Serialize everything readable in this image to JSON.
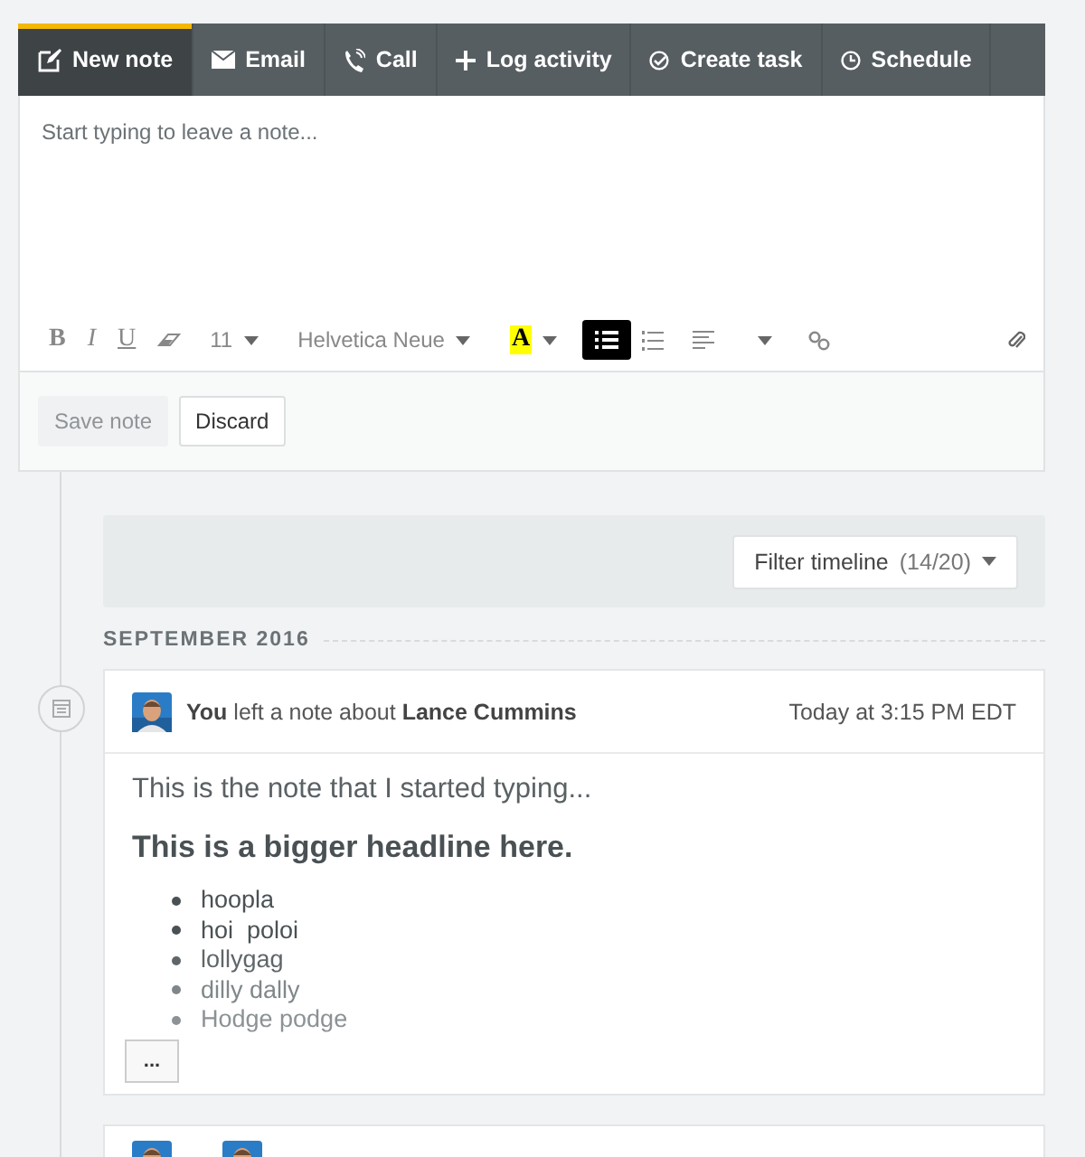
{
  "composer": {
    "tabs": [
      {
        "label": "New note",
        "selected": true
      },
      {
        "label": "Email",
        "selected": false
      },
      {
        "label": "Call",
        "selected": false
      },
      {
        "label": "Log activity",
        "selected": false
      },
      {
        "label": "Create task",
        "selected": false
      },
      {
        "label": "Schedule",
        "selected": false
      }
    ],
    "placeholder": "Start typing to leave a note...",
    "toolbar": {
      "bold": "B",
      "italic": "I",
      "underline": "U",
      "font_size": "11",
      "font_family": "Helvetica Neue",
      "text_color": "A",
      "bullet_list": {
        "selected": true
      },
      "numbered_list": {
        "selected": false
      }
    },
    "buttons": [
      {
        "label": "Save note",
        "disabled": true
      },
      {
        "label": "Discard",
        "disabled": false
      }
    ]
  },
  "timeline": {
    "filter": {
      "label": "Filter timeline",
      "count": "(14/20)"
    },
    "month": "SEPTEMBER 2016",
    "entries": [
      {
        "actor": "You",
        "action": "left a note about",
        "subject": "Lance Cummins",
        "time": "Today at 3:15 PM EDT",
        "text": "This is the note that I started typing...",
        "headline": "This is a bigger headline here.",
        "items": [
          "hoopla",
          "hoi  poloi",
          "lollygag",
          "dilly dally",
          "Hodge podge"
        ],
        "more": "..."
      }
    ]
  }
}
